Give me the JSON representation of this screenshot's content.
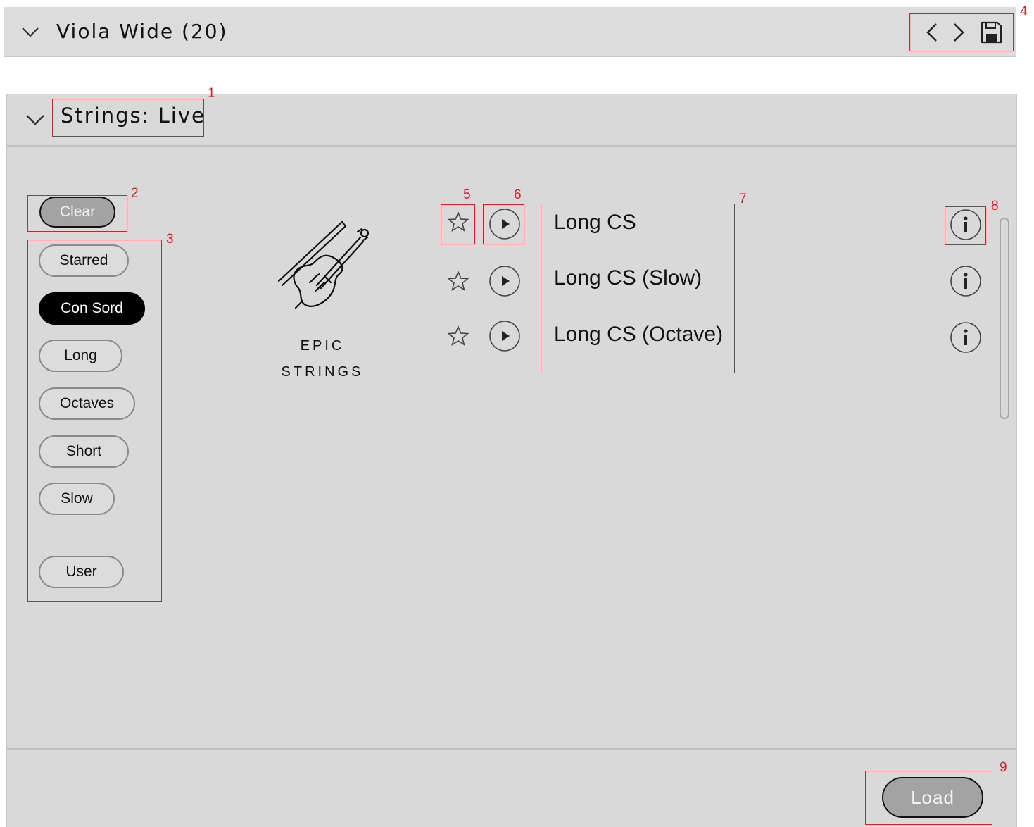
{
  "topbar": {
    "title": "Viola Wide (20)"
  },
  "panel": {
    "title": "Strings: Live"
  },
  "filters": {
    "clear_label": "Clear",
    "tags": [
      {
        "label": "Starred",
        "active": false
      },
      {
        "label": "Con Sord",
        "active": true
      },
      {
        "label": "Long",
        "active": false
      },
      {
        "label": "Octaves",
        "active": false
      },
      {
        "label": "Short",
        "active": false
      },
      {
        "label": "Slow",
        "active": false
      },
      {
        "label": "User",
        "active": false
      }
    ]
  },
  "library": {
    "line1": "EPIC",
    "line2": "STRINGS"
  },
  "patches": [
    {
      "name": "Long CS",
      "starred": false
    },
    {
      "name": "Long CS (Slow)",
      "starred": false
    },
    {
      "name": "Long CS (Octave)",
      "starred": false
    }
  ],
  "footer": {
    "load_label": "Load"
  },
  "annotations": [
    "1",
    "2",
    "3",
    "4",
    "5",
    "6",
    "7",
    "8",
    "9"
  ],
  "colors": {
    "annotation": "#d0202a",
    "panel": "#d9d9d9",
    "active_tag": "#000000"
  }
}
